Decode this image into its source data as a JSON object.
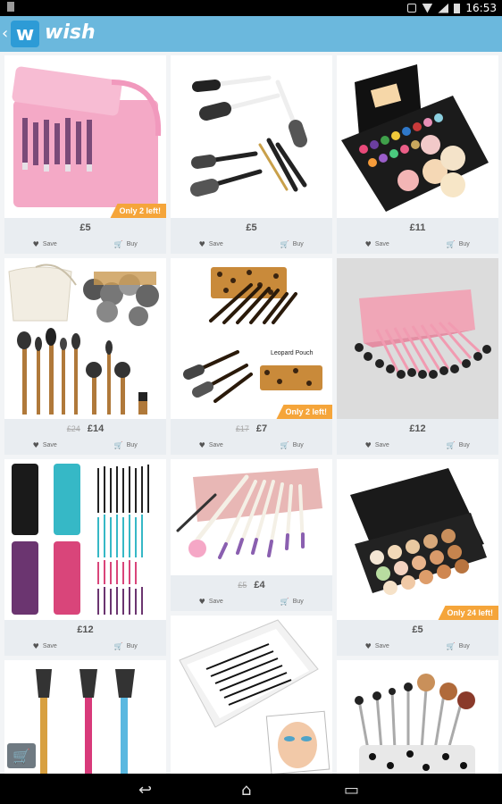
{
  "status": {
    "time": "16:53"
  },
  "appbar": {
    "back_glyph": "‹",
    "logo_letter": "w",
    "brand": "wish"
  },
  "actions": {
    "save": "Save",
    "buy": "Buy"
  },
  "products": [
    {
      "price": "£5",
      "badge": "Only 2 left!"
    },
    {
      "price": "£5"
    },
    {
      "price": "£11"
    },
    {
      "price": "£14",
      "old_price": "£24"
    },
    {
      "price": "£7",
      "old_price": "£17",
      "badge": "Only 2 left!",
      "image_text": "Leopard Pouch"
    },
    {
      "price": "£12"
    },
    {
      "price": "£12"
    },
    {
      "price": "£4",
      "old_price": "£5"
    },
    {
      "price": "£5",
      "badge": "Only 24 left!"
    },
    {},
    {},
    {}
  ],
  "fab": {
    "cart_glyph": "🛒"
  },
  "nav": {
    "back": "↩",
    "home": "⌂",
    "recents": "▭"
  }
}
